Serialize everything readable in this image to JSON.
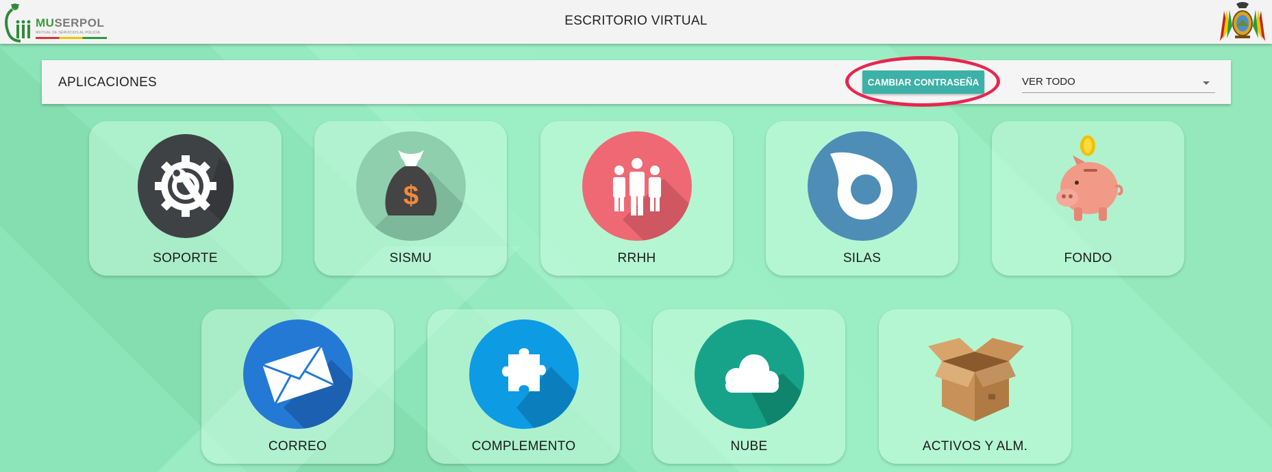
{
  "header": {
    "logo_text_mu": "MU",
    "logo_text_rest": "SERPOL",
    "logo_subtitle": "MUTUAL DE SERVICIOS AL POLICIA",
    "title": "ESCRITORIO VIRTUAL"
  },
  "toolbar": {
    "title": "APLICACIONES",
    "change_password_label": "CAMBIAR CONTRASEÑA",
    "filter_value": "VER TODO"
  },
  "apps": [
    {
      "label": "SOPORTE",
      "icon": "gear-wrench-icon"
    },
    {
      "label": "SISMU",
      "icon": "money-bag-icon"
    },
    {
      "label": "RRHH",
      "icon": "people-group-icon"
    },
    {
      "label": "SILAS",
      "icon": "silas-logo-icon"
    },
    {
      "label": "FONDO",
      "icon": "piggy-bank-icon"
    },
    {
      "label": "CORREO",
      "icon": "envelope-icon"
    },
    {
      "label": "COMPLEMENTO",
      "icon": "puzzle-piece-icon"
    },
    {
      "label": "NUBE",
      "icon": "cloud-icon"
    },
    {
      "label": "ACTIVOS Y ALM.",
      "icon": "cardboard-box-icon"
    }
  ],
  "colors": {
    "accent": "#3cb1a7",
    "highlight_ring": "#e8254f",
    "background": "#8fe8bb"
  }
}
